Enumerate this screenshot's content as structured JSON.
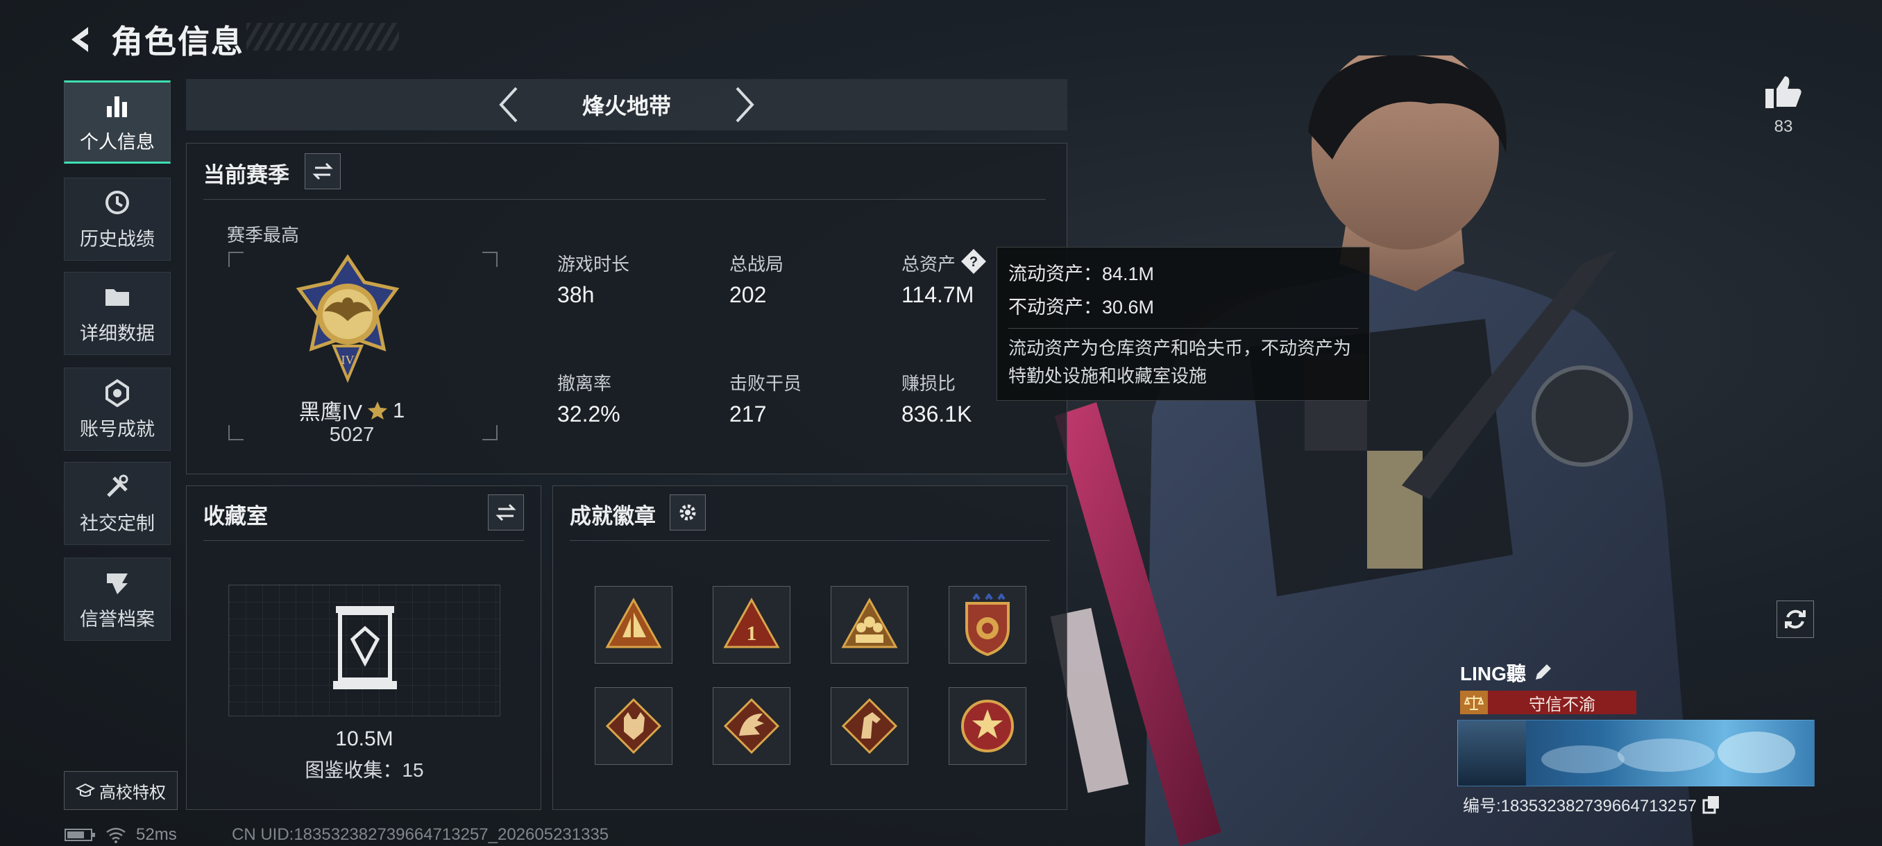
{
  "header": {
    "title": "角色信息"
  },
  "sidebar": {
    "items": [
      {
        "label": "个人信息",
        "icon": "bar-chart-icon",
        "active": true
      },
      {
        "label": "历史战绩",
        "icon": "history-icon",
        "active": false
      },
      {
        "label": "详细数据",
        "icon": "folder-icon",
        "active": false
      },
      {
        "label": "账号成就",
        "icon": "achievement-icon",
        "active": false
      },
      {
        "label": "社交定制",
        "icon": "tools-icon",
        "active": false
      },
      {
        "label": "信誉档案",
        "icon": "shield-icon",
        "active": false
      }
    ],
    "school_label": "高校特权"
  },
  "mode_bar": {
    "name": "烽火地带"
  },
  "season": {
    "title": "当前赛季",
    "best_label": "赛季最高",
    "rank_name": "黑鹰IV",
    "rank_stars": "1",
    "rank_points": "5027",
    "stats": [
      {
        "label": "游戏时长",
        "value": "38h"
      },
      {
        "label": "总战局",
        "value": "202"
      },
      {
        "label": "总资产",
        "value": "114.7M"
      },
      {
        "label": "撤离率",
        "value": "32.2%"
      },
      {
        "label": "击败干员",
        "value": "217"
      },
      {
        "label": "赚损比",
        "value": "836.1K"
      }
    ],
    "help_icon": "?"
  },
  "tooltip": {
    "liquid": "流动资产：84.1M",
    "fixed": "不动资产：30.6M",
    "desc": "流动资产为仓库资产和哈夫币，不动资产为特勤处设施和收藏室设施"
  },
  "collection": {
    "title": "收藏室",
    "value": "10.5M",
    "catalog": "图鉴收集：15"
  },
  "badges": {
    "title": "成就徽章",
    "items": [
      "sailboat-badge",
      "rank-one-badge",
      "squad-badge",
      "shield-star-badge",
      "wolf-badge",
      "dragon-badge",
      "horse-badge",
      "star-medal-badge"
    ]
  },
  "player": {
    "likes": "83",
    "name": "LING聽",
    "reputation": "守信不渝",
    "id_text": "编号:1835323827396647132 57"
  },
  "status": {
    "ping": "52ms",
    "uid": "CN UID:183532382739664713257_202605231335"
  },
  "colors": {
    "accent": "#3ee0b0",
    "rep_red": "#8a1e1e",
    "gold": "#c9a24a"
  }
}
